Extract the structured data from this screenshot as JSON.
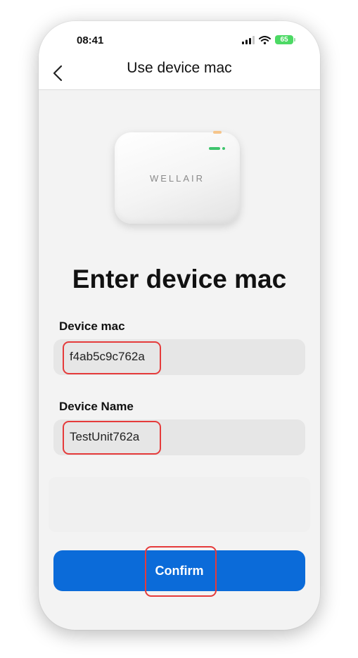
{
  "status_bar": {
    "time": "08:41",
    "battery": "65"
  },
  "header": {
    "title": "Use device mac"
  },
  "device": {
    "brand": "WELLAIR"
  },
  "main": {
    "heading": "Enter device mac",
    "mac_label": "Device mac",
    "mac_value": "f4ab5c9c762a",
    "name_label": "Device Name",
    "name_value": "TestUnit762a",
    "confirm_label": "Confirm"
  },
  "colors": {
    "accent": "#0b6bd9",
    "highlight": "#e53b3b",
    "battery": "#4cd964"
  }
}
